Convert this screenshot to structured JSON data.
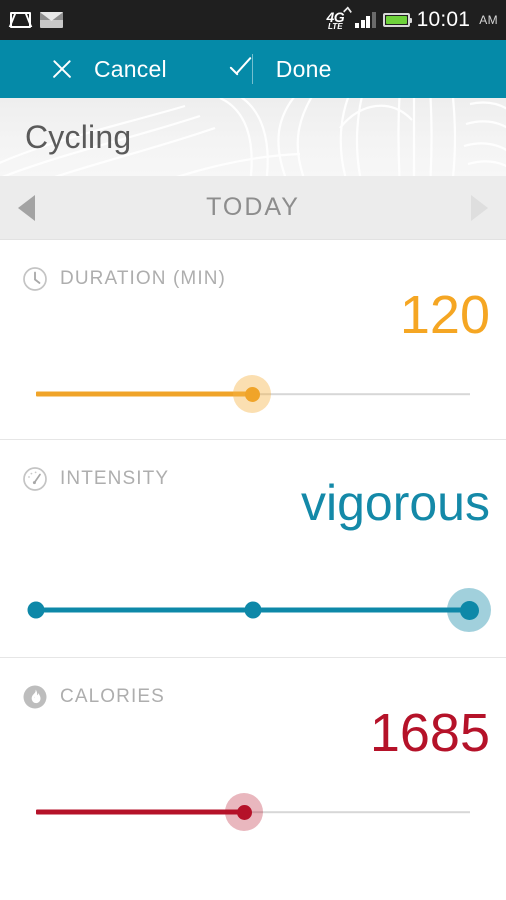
{
  "status_bar": {
    "icons": [
      "gmail-icon",
      "mail-icon"
    ],
    "network": {
      "type": "4G",
      "sub": "LTE"
    },
    "signal_bars": 3,
    "battery_icon": "battery-full-icon",
    "time": "10:01",
    "ampm": "AM"
  },
  "action_bar": {
    "cancel_label": "Cancel",
    "cancel_icon": "close-x-icon",
    "done_label": "Done",
    "done_icon": "check-icon",
    "background_color": "#058AA8"
  },
  "header": {
    "activity_title": "Cycling"
  },
  "date_nav": {
    "label": "TODAY",
    "prev_icon": "triangle-left-icon",
    "next_icon": "triangle-right-icon"
  },
  "metrics": [
    {
      "key": "duration",
      "label": "DURATION (MIN)",
      "icon": "clock-icon",
      "value": "120",
      "color": "#F5A623",
      "slider": {
        "percent": 51,
        "type": "continuous"
      }
    },
    {
      "key": "intensity",
      "label": "INTENSITY",
      "icon": "gauge-icon",
      "value": "vigorous",
      "color": "#1489A8",
      "slider": {
        "percent": 100,
        "type": "discrete",
        "steps": 3,
        "selected_step": 3
      }
    },
    {
      "key": "calories",
      "label": "CALORIES",
      "icon": "flame-icon",
      "value": "1685",
      "color": "#B51229",
      "slider": {
        "percent": 48,
        "type": "continuous"
      }
    }
  ]
}
